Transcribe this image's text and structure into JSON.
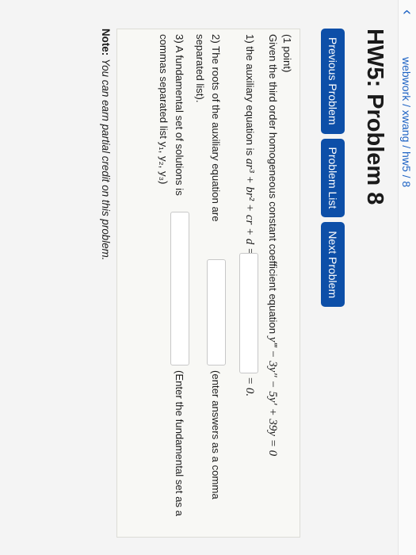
{
  "breadcrumb": "webwork / xwang / hw5 / 8",
  "page_title": "HW5: Problem 8",
  "nav": {
    "previous": "Previous Problem",
    "list": "Problem List",
    "next": "Next Problem"
  },
  "problem": {
    "points": "(1 point)",
    "intro": "Given the third order homogeneous constant coefficient equation",
    "equation": "y‴ − 3y″ − 5y′ + 39y = 0",
    "part1_label": "1) the auxiliary equation is",
    "part1_expr": "ar³ + br² + cr + d =",
    "part1_suffix": "= 0.",
    "part2_label": "2) The roots of the auxiliary equation are",
    "part2_hint_a": "(enter answers as a comma",
    "part2_hint_b": "separated list).",
    "part3_label": "3) A fundamental set of solutions is",
    "part3_hint_a": "(Enter the fundamental set as a",
    "part3_hint_b": "commas separated list y₁, y₂, y₃)",
    "answer1_value": "",
    "answer2_value": "",
    "answer3_value": ""
  },
  "note": {
    "label": "Note:",
    "text": "You can earn partial credit on this problem."
  }
}
